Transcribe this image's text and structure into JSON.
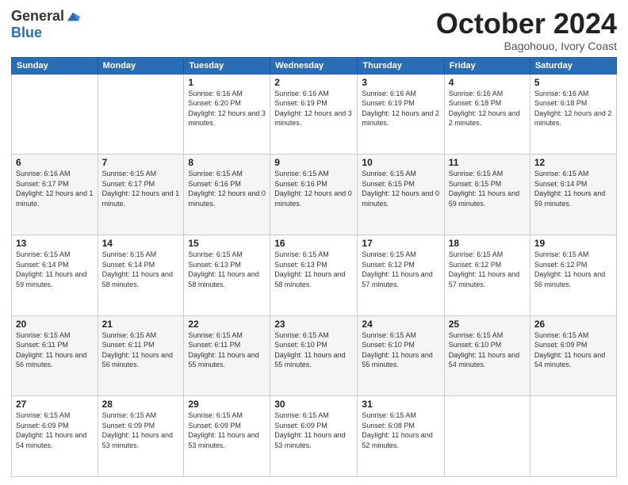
{
  "logo": {
    "general": "General",
    "blue": "Blue"
  },
  "title": "October 2024",
  "subtitle": "Bagohouo, Ivory Coast",
  "days_of_week": [
    "Sunday",
    "Monday",
    "Tuesday",
    "Wednesday",
    "Thursday",
    "Friday",
    "Saturday"
  ],
  "weeks": [
    [
      {
        "day": "",
        "info": ""
      },
      {
        "day": "",
        "info": ""
      },
      {
        "day": "1",
        "info": "Sunrise: 6:16 AM\nSunset: 6:20 PM\nDaylight: 12 hours and 3 minutes."
      },
      {
        "day": "2",
        "info": "Sunrise: 6:16 AM\nSunset: 6:19 PM\nDaylight: 12 hours and 3 minutes."
      },
      {
        "day": "3",
        "info": "Sunrise: 6:16 AM\nSunset: 6:19 PM\nDaylight: 12 hours and 2 minutes."
      },
      {
        "day": "4",
        "info": "Sunrise: 6:16 AM\nSunset: 6:18 PM\nDaylight: 12 hours and 2 minutes."
      },
      {
        "day": "5",
        "info": "Sunrise: 6:16 AM\nSunset: 6:18 PM\nDaylight: 12 hours and 2 minutes."
      }
    ],
    [
      {
        "day": "6",
        "info": "Sunrise: 6:16 AM\nSunset: 6:17 PM\nDaylight: 12 hours and 1 minute."
      },
      {
        "day": "7",
        "info": "Sunrise: 6:15 AM\nSunset: 6:17 PM\nDaylight: 12 hours and 1 minute."
      },
      {
        "day": "8",
        "info": "Sunrise: 6:15 AM\nSunset: 6:16 PM\nDaylight: 12 hours and 0 minutes."
      },
      {
        "day": "9",
        "info": "Sunrise: 6:15 AM\nSunset: 6:16 PM\nDaylight: 12 hours and 0 minutes."
      },
      {
        "day": "10",
        "info": "Sunrise: 6:15 AM\nSunset: 6:15 PM\nDaylight: 12 hours and 0 minutes."
      },
      {
        "day": "11",
        "info": "Sunrise: 6:15 AM\nSunset: 6:15 PM\nDaylight: 11 hours and 59 minutes."
      },
      {
        "day": "12",
        "info": "Sunrise: 6:15 AM\nSunset: 6:14 PM\nDaylight: 11 hours and 59 minutes."
      }
    ],
    [
      {
        "day": "13",
        "info": "Sunrise: 6:15 AM\nSunset: 6:14 PM\nDaylight: 11 hours and 59 minutes."
      },
      {
        "day": "14",
        "info": "Sunrise: 6:15 AM\nSunset: 6:14 PM\nDaylight: 11 hours and 58 minutes."
      },
      {
        "day": "15",
        "info": "Sunrise: 6:15 AM\nSunset: 6:13 PM\nDaylight: 11 hours and 58 minutes."
      },
      {
        "day": "16",
        "info": "Sunrise: 6:15 AM\nSunset: 6:13 PM\nDaylight: 11 hours and 58 minutes."
      },
      {
        "day": "17",
        "info": "Sunrise: 6:15 AM\nSunset: 6:12 PM\nDaylight: 11 hours and 57 minutes."
      },
      {
        "day": "18",
        "info": "Sunrise: 6:15 AM\nSunset: 6:12 PM\nDaylight: 11 hours and 57 minutes."
      },
      {
        "day": "19",
        "info": "Sunrise: 6:15 AM\nSunset: 6:12 PM\nDaylight: 11 hours and 56 minutes."
      }
    ],
    [
      {
        "day": "20",
        "info": "Sunrise: 6:15 AM\nSunset: 6:11 PM\nDaylight: 11 hours and 56 minutes."
      },
      {
        "day": "21",
        "info": "Sunrise: 6:15 AM\nSunset: 6:11 PM\nDaylight: 11 hours and 56 minutes."
      },
      {
        "day": "22",
        "info": "Sunrise: 6:15 AM\nSunset: 6:11 PM\nDaylight: 11 hours and 55 minutes."
      },
      {
        "day": "23",
        "info": "Sunrise: 6:15 AM\nSunset: 6:10 PM\nDaylight: 11 hours and 55 minutes."
      },
      {
        "day": "24",
        "info": "Sunrise: 6:15 AM\nSunset: 6:10 PM\nDaylight: 11 hours and 55 minutes."
      },
      {
        "day": "25",
        "info": "Sunrise: 6:15 AM\nSunset: 6:10 PM\nDaylight: 11 hours and 54 minutes."
      },
      {
        "day": "26",
        "info": "Sunrise: 6:15 AM\nSunset: 6:09 PM\nDaylight: 11 hours and 54 minutes."
      }
    ],
    [
      {
        "day": "27",
        "info": "Sunrise: 6:15 AM\nSunset: 6:09 PM\nDaylight: 11 hours and 54 minutes."
      },
      {
        "day": "28",
        "info": "Sunrise: 6:15 AM\nSunset: 6:09 PM\nDaylight: 11 hours and 53 minutes."
      },
      {
        "day": "29",
        "info": "Sunrise: 6:15 AM\nSunset: 6:09 PM\nDaylight: 11 hours and 53 minutes."
      },
      {
        "day": "30",
        "info": "Sunrise: 6:15 AM\nSunset: 6:09 PM\nDaylight: 11 hours and 53 minutes."
      },
      {
        "day": "31",
        "info": "Sunrise: 6:15 AM\nSunset: 6:08 PM\nDaylight: 11 hours and 52 minutes."
      },
      {
        "day": "",
        "info": ""
      },
      {
        "day": "",
        "info": ""
      }
    ]
  ]
}
